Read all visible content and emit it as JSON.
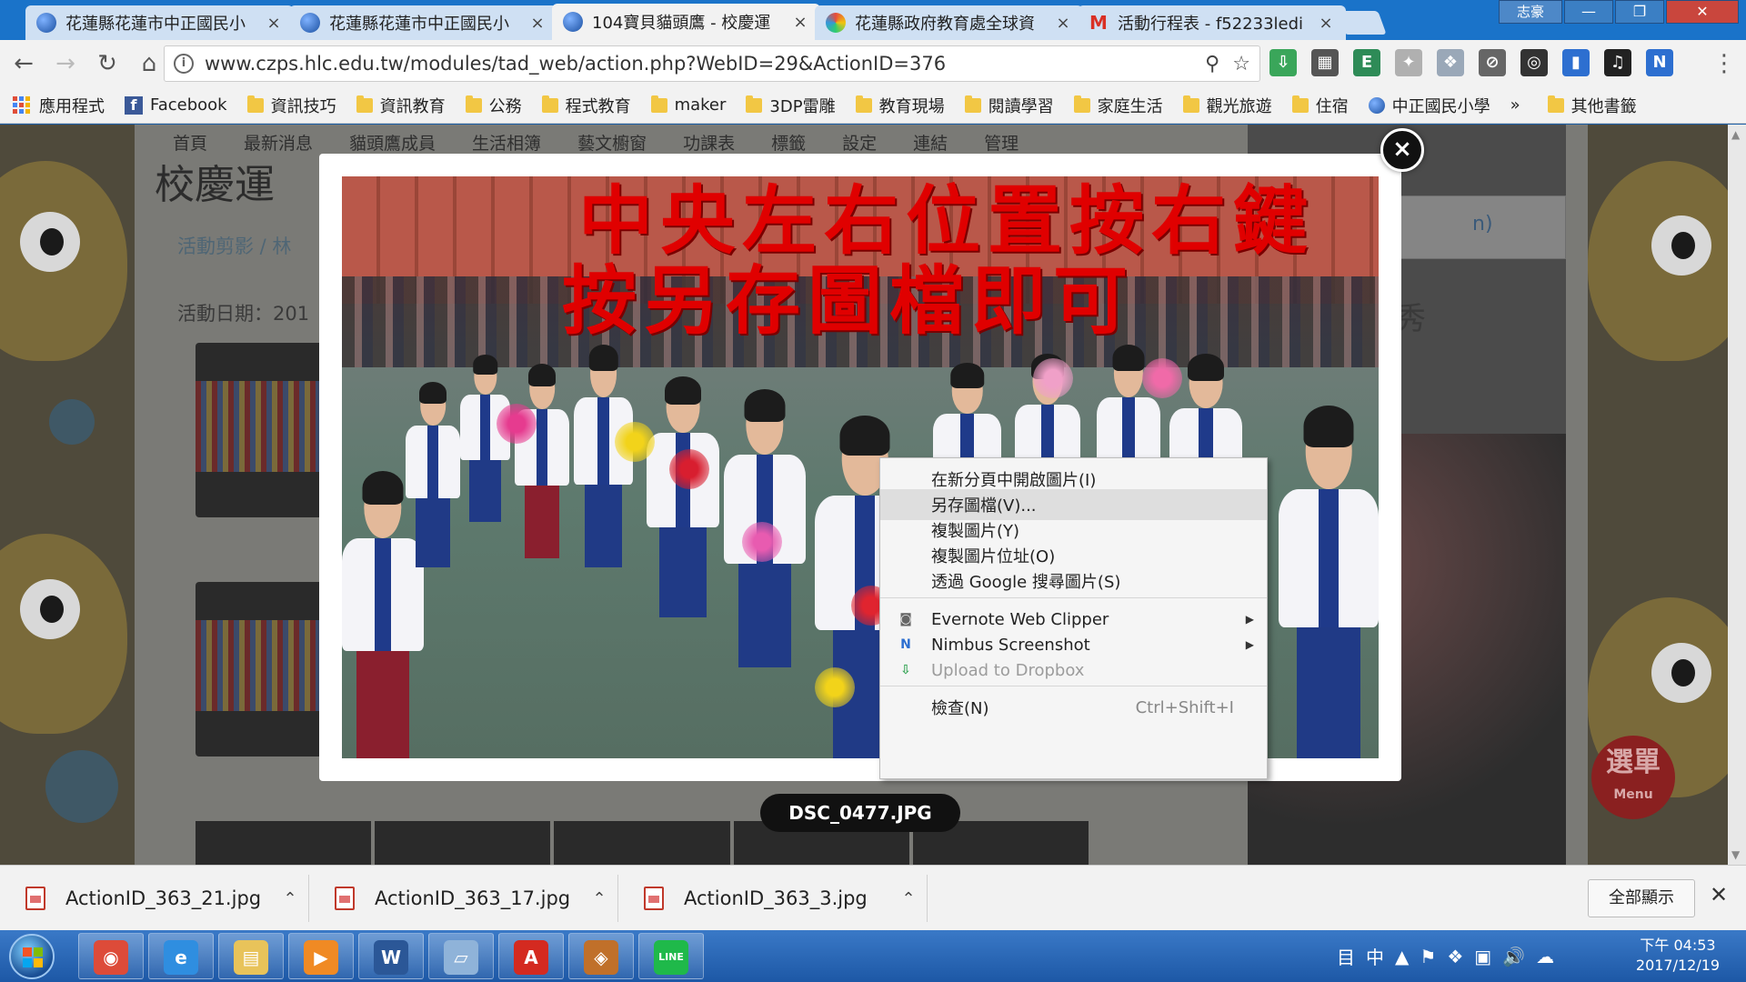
{
  "browser": {
    "tabs": [
      {
        "title": "花蓮縣花蓮市中正國民小",
        "icon": "globe-icon"
      },
      {
        "title": "花蓮縣花蓮市中正國民小",
        "icon": "globe-icon"
      },
      {
        "title": "104寶貝貓頭鷹 - 校慶運",
        "icon": "globe-icon"
      },
      {
        "title": "花蓮縣政府教育處全球資",
        "icon": "colorful-icon"
      },
      {
        "title": "活動行程表 - f52233ledi",
        "icon": "gmail-icon"
      }
    ],
    "active_tab_index": 2,
    "tab_close_glyph": "×",
    "user_label": "志豪",
    "window_controls": {
      "minimize": "—",
      "maximize": "❐",
      "close": "✕"
    },
    "address": "www.czps.hlc.edu.tw/modules/tad_web/action.php?WebID=29&ActionID=376",
    "info_glyph": "i",
    "nav": {
      "back": "←",
      "forward": "→",
      "reload": "↻",
      "home": "⌂",
      "zoom": "⚲",
      "star": "☆",
      "menu": "⋮"
    },
    "extensions": [
      {
        "name": "download-extension-icon",
        "glyph": "⇩",
        "color": "#3aa65a"
      },
      {
        "name": "photo-extension-icon",
        "glyph": "▦",
        "color": "#555555"
      },
      {
        "name": "evernote-extension-icon",
        "glyph": "E",
        "color": "#2e8b57"
      },
      {
        "name": "puzzle-extension-icon",
        "glyph": "✦",
        "color": "#b0b0b0"
      },
      {
        "name": "dropbox-extension-icon",
        "glyph": "❖",
        "color": "#9aa8b8"
      },
      {
        "name": "blocked-extension-icon",
        "glyph": "⊘",
        "color": "#666666"
      },
      {
        "name": "glasses-extension-icon",
        "glyph": "◎",
        "color": "#333333"
      },
      {
        "name": "bookmark-extension-icon",
        "glyph": "▮",
        "color": "#2d6fd0"
      },
      {
        "name": "headphones-extension-icon",
        "glyph": "♫",
        "color": "#222222"
      },
      {
        "name": "nimbus-extension-icon",
        "glyph": "N",
        "color": "#2d6fd0"
      }
    ]
  },
  "bookmarks": {
    "items": [
      {
        "label": "應用程式",
        "kind": "apps"
      },
      {
        "label": "Facebook",
        "kind": "facebook"
      },
      {
        "label": "資訊技巧",
        "kind": "folder"
      },
      {
        "label": "資訊教育",
        "kind": "folder"
      },
      {
        "label": "公務",
        "kind": "folder"
      },
      {
        "label": "程式教育",
        "kind": "folder"
      },
      {
        "label": "maker",
        "kind": "folder"
      },
      {
        "label": "3DP雷雕",
        "kind": "folder"
      },
      {
        "label": "教育現場",
        "kind": "folder"
      },
      {
        "label": "閱讀學習",
        "kind": "folder"
      },
      {
        "label": "家庭生活",
        "kind": "folder"
      },
      {
        "label": "觀光旅遊",
        "kind": "folder"
      },
      {
        "label": "住宿",
        "kind": "folder"
      },
      {
        "label": "中正國民小學",
        "kind": "globe"
      }
    ],
    "overflow": "»",
    "other": "其他書籤"
  },
  "page": {
    "nav": [
      "首頁",
      "最新消息",
      "貓頭鷹成員",
      "生活相簿",
      "藝文櫥窗",
      "功課表",
      "標籤",
      "設定",
      "連結",
      "管理"
    ],
    "title_partial": "校慶運",
    "breadcrumb": "活動剪影 / 林",
    "activity_date_label": "活動日期：201",
    "right_partial_text": "秀",
    "right_partial_link": "n)",
    "menu_badge": {
      "title": "選單",
      "subtitle": "Menu"
    }
  },
  "lightbox": {
    "overlay_text_line1": "中央左右位置按右鍵",
    "overlay_text_line2": "按另存圖檔即可",
    "filename": "DSC_0477.JPG",
    "close_glyph": "×"
  },
  "context_menu": {
    "items": [
      {
        "label": "在新分頁中開啟圖片(I)",
        "highlighted": false,
        "disabled": false
      },
      {
        "label": "另存圖檔(V)...",
        "highlighted": true,
        "disabled": false
      },
      {
        "label": "複製圖片(Y)",
        "highlighted": false,
        "disabled": false
      },
      {
        "label": "複製圖片位址(O)",
        "highlighted": false,
        "disabled": false
      },
      {
        "label": "透過 Google 搜尋圖片(S)",
        "highlighted": false,
        "disabled": false
      },
      {
        "label": "Evernote Web Clipper",
        "highlighted": false,
        "disabled": false,
        "submenu": true
      },
      {
        "label": "Nimbus Screenshot",
        "highlighted": false,
        "disabled": false,
        "submenu": true
      },
      {
        "label": "Upload to Dropbox",
        "highlighted": false,
        "disabled": true
      },
      {
        "label": "檢查(N)",
        "highlighted": false,
        "disabled": false,
        "shortcut": "Ctrl+Shift+I"
      }
    ]
  },
  "downloads": {
    "files": [
      "ActionID_363_21.jpg",
      "ActionID_363_17.jpg",
      "ActionID_363_3.jpg"
    ],
    "show_all": "全部顯示",
    "close_glyph": "✕"
  },
  "taskbar": {
    "apps": [
      {
        "name": "chrome-taskbar-icon",
        "glyph": "◉",
        "color": "#dd4b39"
      },
      {
        "name": "ie-taskbar-icon",
        "glyph": "e",
        "color": "#2f8ee0"
      },
      {
        "name": "explorer-taskbar-icon",
        "glyph": "▤",
        "color": "#e8c35a"
      },
      {
        "name": "media-player-taskbar-icon",
        "glyph": "▶",
        "color": "#f08a24"
      },
      {
        "name": "word-taskbar-icon",
        "glyph": "W",
        "color": "#2b5797"
      },
      {
        "name": "notepad-taskbar-icon",
        "glyph": "▱",
        "color": "#8fb3d9"
      },
      {
        "name": "acrobat-taskbar-icon",
        "glyph": "A",
        "color": "#d42a20"
      },
      {
        "name": "eye-app-taskbar-icon",
        "glyph": "◈",
        "color": "#c0702a"
      },
      {
        "name": "line-taskbar-icon",
        "glyph": "LINE",
        "color": "#1fb94a"
      }
    ],
    "tray": [
      "目",
      "中",
      "▲",
      "⚑",
      "❖",
      "▣",
      "🔊",
      "☁"
    ],
    "time": "下午 04:53",
    "date": "2017/12/19"
  }
}
